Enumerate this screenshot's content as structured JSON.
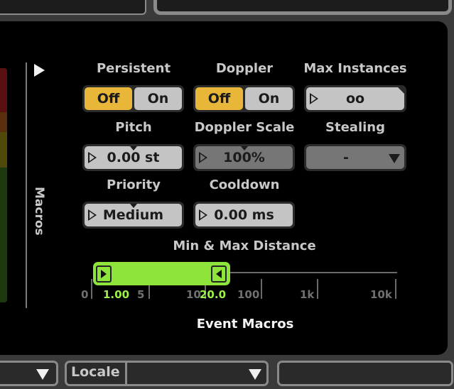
{
  "macros": {
    "section_label": "Macros",
    "event_macros_label": "Event Macros",
    "persistent": {
      "label": "Persistent",
      "off_label": "Off",
      "on_label": "On",
      "selected": "Off"
    },
    "doppler": {
      "label": "Doppler",
      "off_label": "Off",
      "on_label": "On",
      "selected": "Off"
    },
    "max_instances": {
      "label": "Max Instances",
      "value": "oo"
    },
    "pitch": {
      "label": "Pitch",
      "value": "0.00 st"
    },
    "doppler_scale": {
      "label": "Doppler Scale",
      "value": "100%"
    },
    "stealing": {
      "label": "Stealing",
      "value": "-"
    },
    "priority": {
      "label": "Priority",
      "value": "Medium"
    },
    "cooldown": {
      "label": "Cooldown",
      "value": "0.00 ms"
    },
    "distance": {
      "label": "Min & Max Distance",
      "min_value": "1.00",
      "max_value": "20.0",
      "min": 1.0,
      "max": 20.0,
      "tick_labels": [
        "0",
        "5",
        "10",
        "100",
        "1k",
        "10k"
      ]
    }
  },
  "bottom": {
    "locale_label": "Locale"
  },
  "colors": {
    "accent_yellow": "#e8b73a",
    "range_green": "#8fe43c",
    "panel_bg": "#000000",
    "control_grey": "#c4c4c4"
  }
}
